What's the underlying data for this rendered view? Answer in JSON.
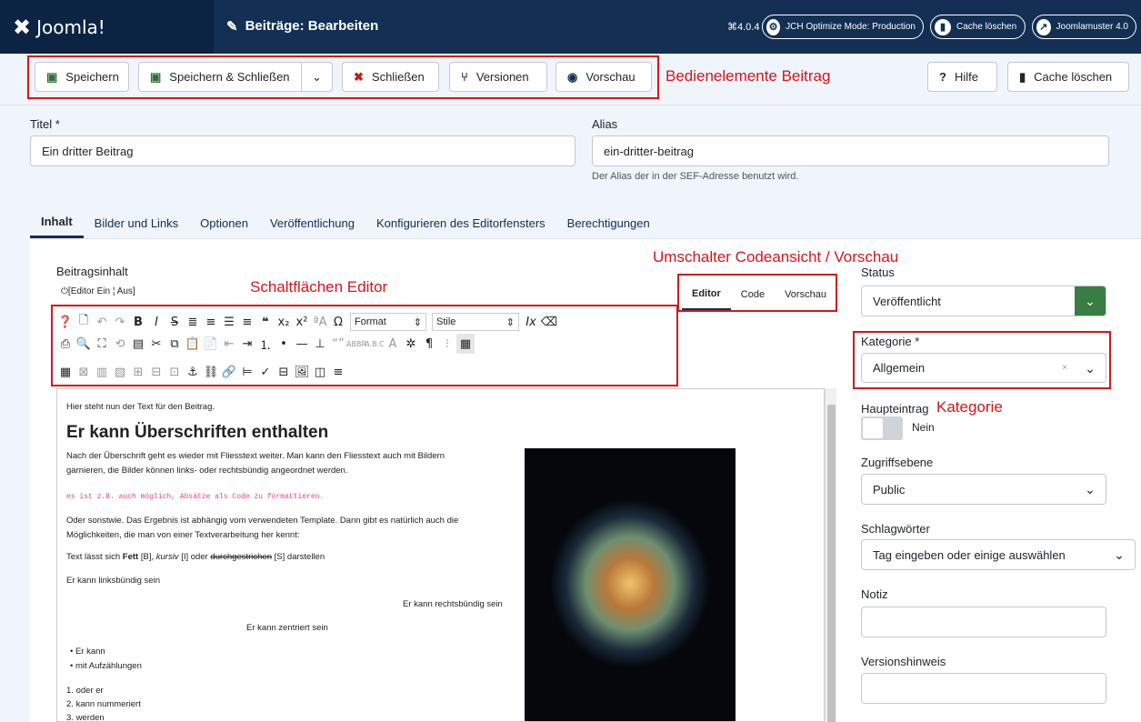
{
  "topbar": {
    "logo_mark": "✖",
    "logo_text": "Joomla!",
    "page_title_icon": "pencil-icon",
    "page_title": "Beiträge: Bearbeiten",
    "version": "⌘4.0.4",
    "buttons": [
      {
        "icon": "gear-icon",
        "glyph": "⚙",
        "label": "JCH Optimize Mode: Production"
      },
      {
        "icon": "trash-icon",
        "glyph": "🗑",
        "label": "Cache löschen"
      },
      {
        "icon": "external-link-icon",
        "glyph": "↗",
        "label": "Joomlamuster 4.0"
      }
    ]
  },
  "toolbar": {
    "save": "Speichern",
    "save_close": "Speichern & Schließen",
    "close": "Schließen",
    "versions": "Versionen",
    "preview": "Vorschau",
    "help": "Hilfe",
    "cache": "Cache löschen",
    "annotation": "Bedienelemente Beitrag"
  },
  "form": {
    "title_label": "Titel *",
    "title_value": "Ein dritter Beitrag",
    "alias_label": "Alias",
    "alias_value": "ein-dritter-beitrag",
    "alias_hint": "Der Alias der in der SEF-Adresse benutzt wird."
  },
  "tabs": [
    "Inhalt",
    "Bilder und Links",
    "Optionen",
    "Veröffentlichung",
    "Konfigurieren des Editorfensters",
    "Berechtigungen"
  ],
  "editor": {
    "label": "Beitragsinhalt",
    "toggle": "⏻[Editor Ein ¦ Aus]",
    "annotation_buttons": "Schaltflächen Editor",
    "annotation_switch": "Umschalter Codeansicht / Vorschau",
    "switch_tabs": [
      "Editor",
      "Code",
      "Vorschau"
    ],
    "format_select": "Format",
    "style_select": "Stile",
    "content": {
      "p1": "Hier steht nun der Text für den Beitrag.",
      "h": "Er kann Überschriften enthalten",
      "p2a": "Nach der Überschrift geht es wieder mit Fliesstext weiter.  Man kann den Fliesstext auch mit Bildern",
      "p2b": "garnieren, die Bilder können links- oder rechtsbündig angeordnet werden.",
      "code": "es ist z.B. auch möglich, Absätze als Code zu formattieren.",
      "p3a": "Oder sonstwie. Das Ergebnis ist abhängig vom verwendeten Template. Dann gibt es natürlich auch die",
      "p3b": "Möglichkeiten, die man von einer Textverarbeitung her kennt:",
      "p4_pre": "Text lässt sich ",
      "p4_bold": "Fett",
      "p4_b": " [B], ",
      "p4_italic": "kursiv",
      "p4_i": " [I] oder ",
      "p4_strike": "durchgestrichen",
      "p4_post": " [S] darstellen",
      "left": "Er kann linksbündig sein",
      "right": "Er kann rechtsbündig sein",
      "center": "Er kann zentriert sein",
      "ul": [
        "Er kann",
        "mit Aufzählungen"
      ],
      "ol": [
        "oder er",
        "kann nummeriert",
        "werden"
      ]
    }
  },
  "sidebar": {
    "status_label": "Status",
    "status_value": "Veröffentlicht",
    "category_label": "Kategorie *",
    "category_value": "Allgemein",
    "category_annotation": "Kategorie",
    "featured_label": "Haupteintrag",
    "featured_value": "Nein",
    "access_label": "Zugriffsebene",
    "access_value": "Public",
    "tags_label": "Schlagwörter",
    "tags_placeholder": "Tag eingeben oder einige auswählen",
    "note_label": "Notiz",
    "version_note_label": "Versionshinweis"
  },
  "colors": {
    "header": "#132f53",
    "accent_green": "#3a7d44",
    "annotation_red": "#d4161c"
  }
}
